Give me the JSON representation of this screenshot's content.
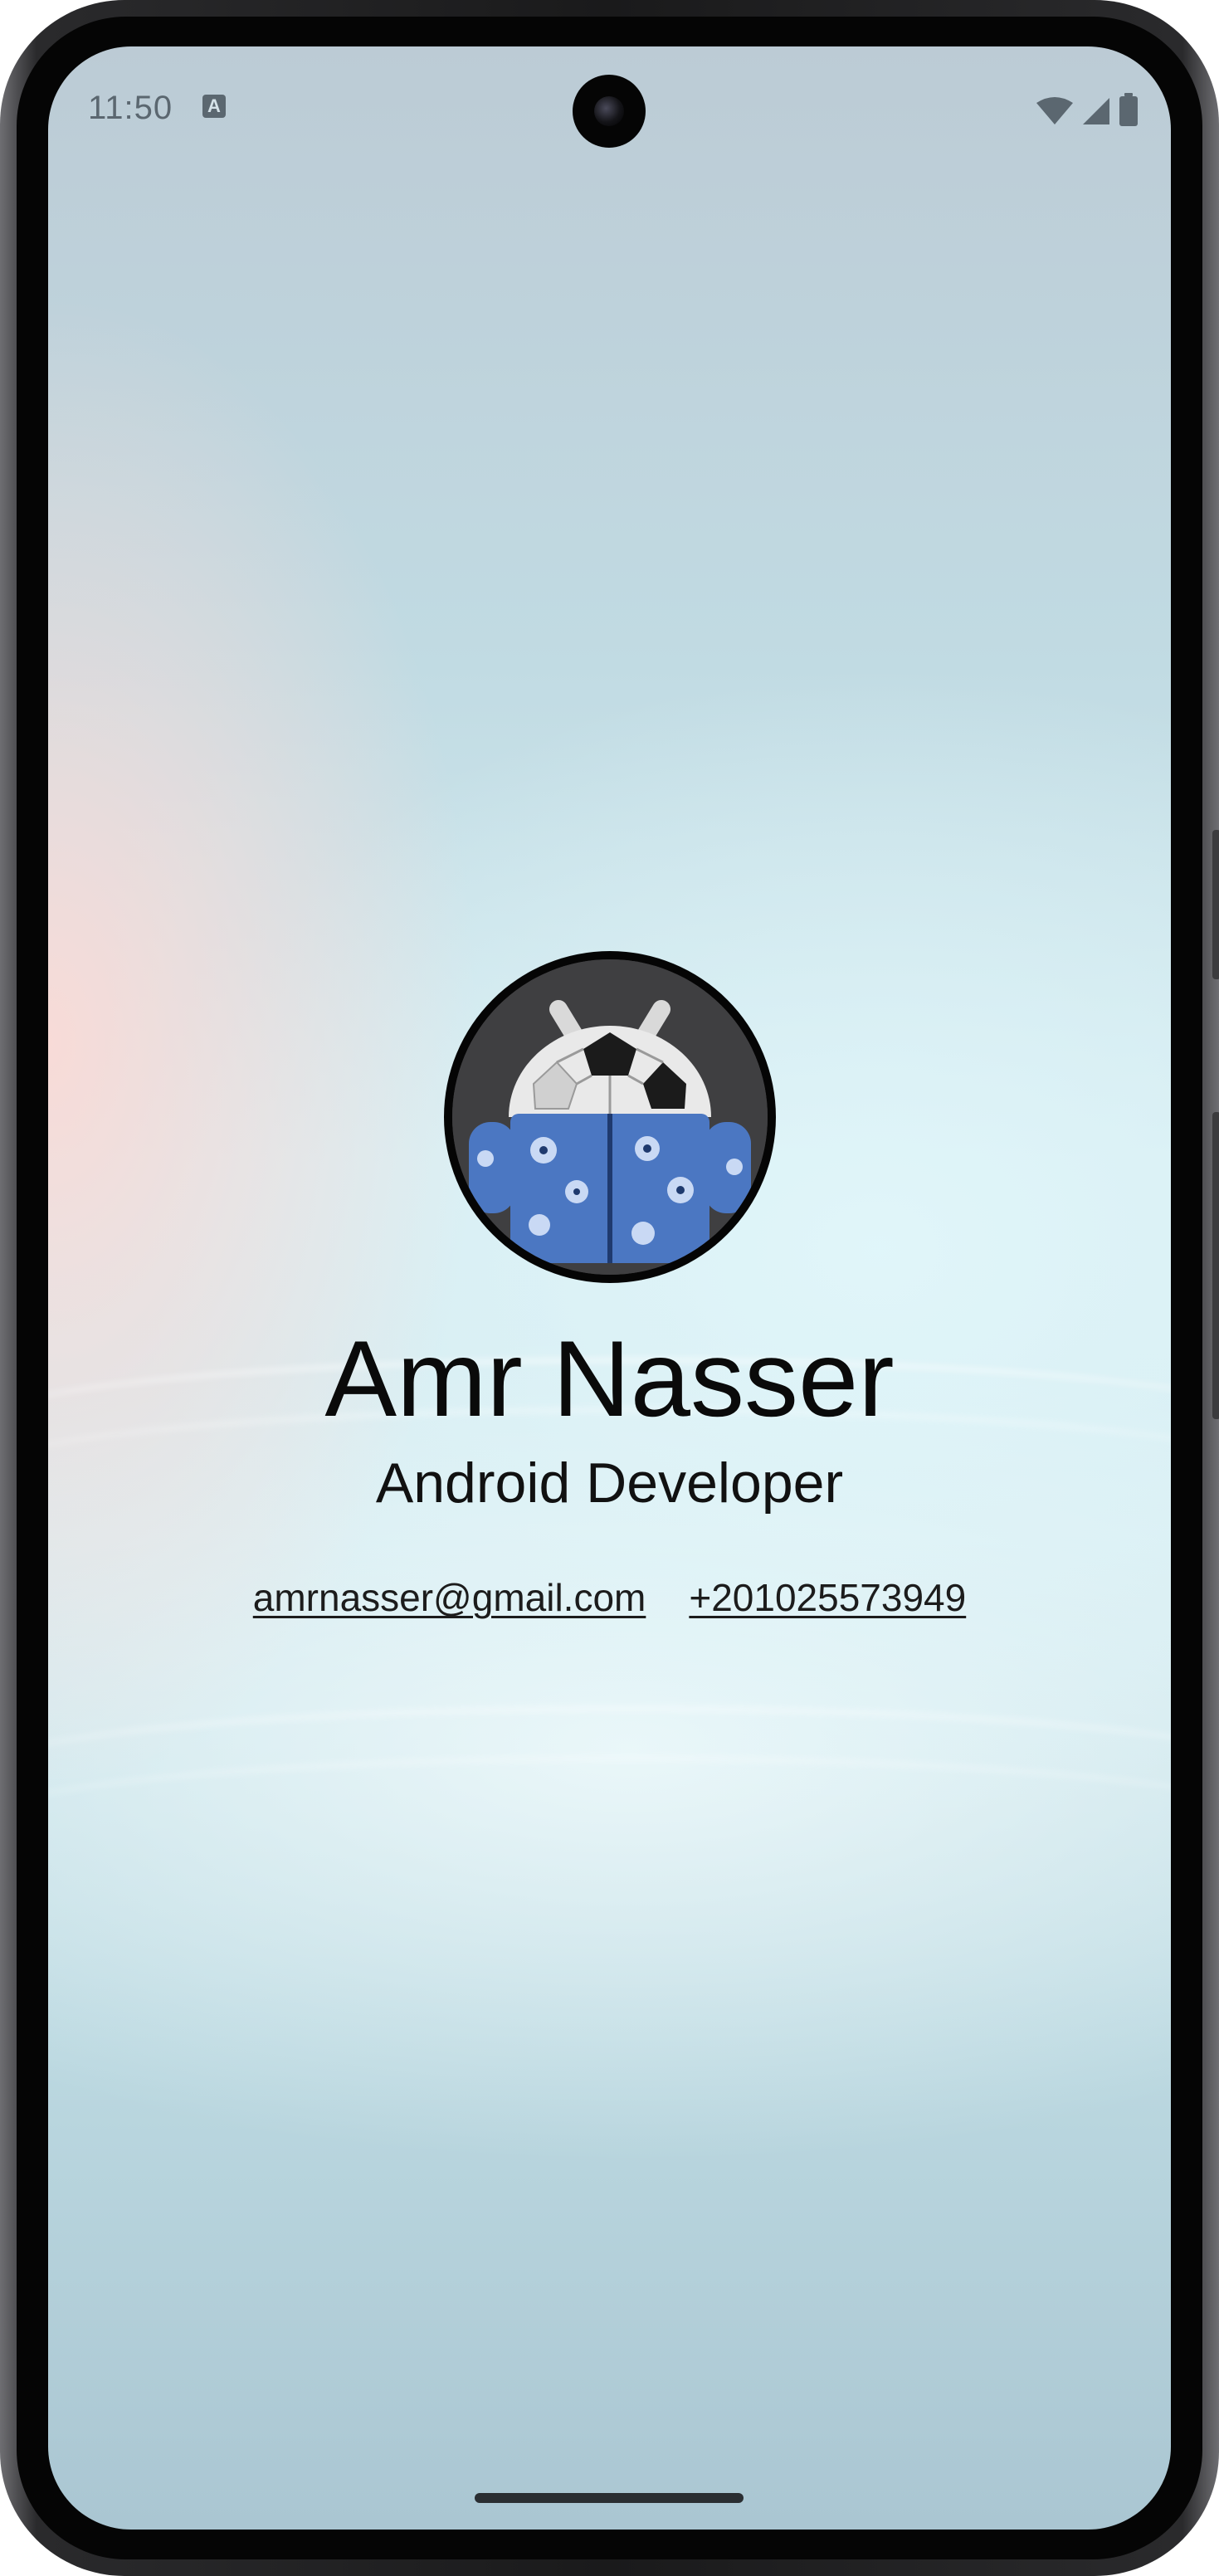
{
  "status_bar": {
    "time": "11:50",
    "notification_icon_letter": "A",
    "icons": [
      "wifi-icon",
      "cellular-signal-icon",
      "battery-icon"
    ]
  },
  "profile": {
    "avatar_icon": "android-avatar-image",
    "name": "Amr Nasser",
    "title": "Android Developer"
  },
  "contacts": {
    "email": "amrnasser@gmail.com",
    "phone": "+201025573949"
  },
  "colors": {
    "text_primary": "#0a0a0a",
    "avatar_border": "#050505",
    "shirt_blue": "#4b77c2"
  }
}
